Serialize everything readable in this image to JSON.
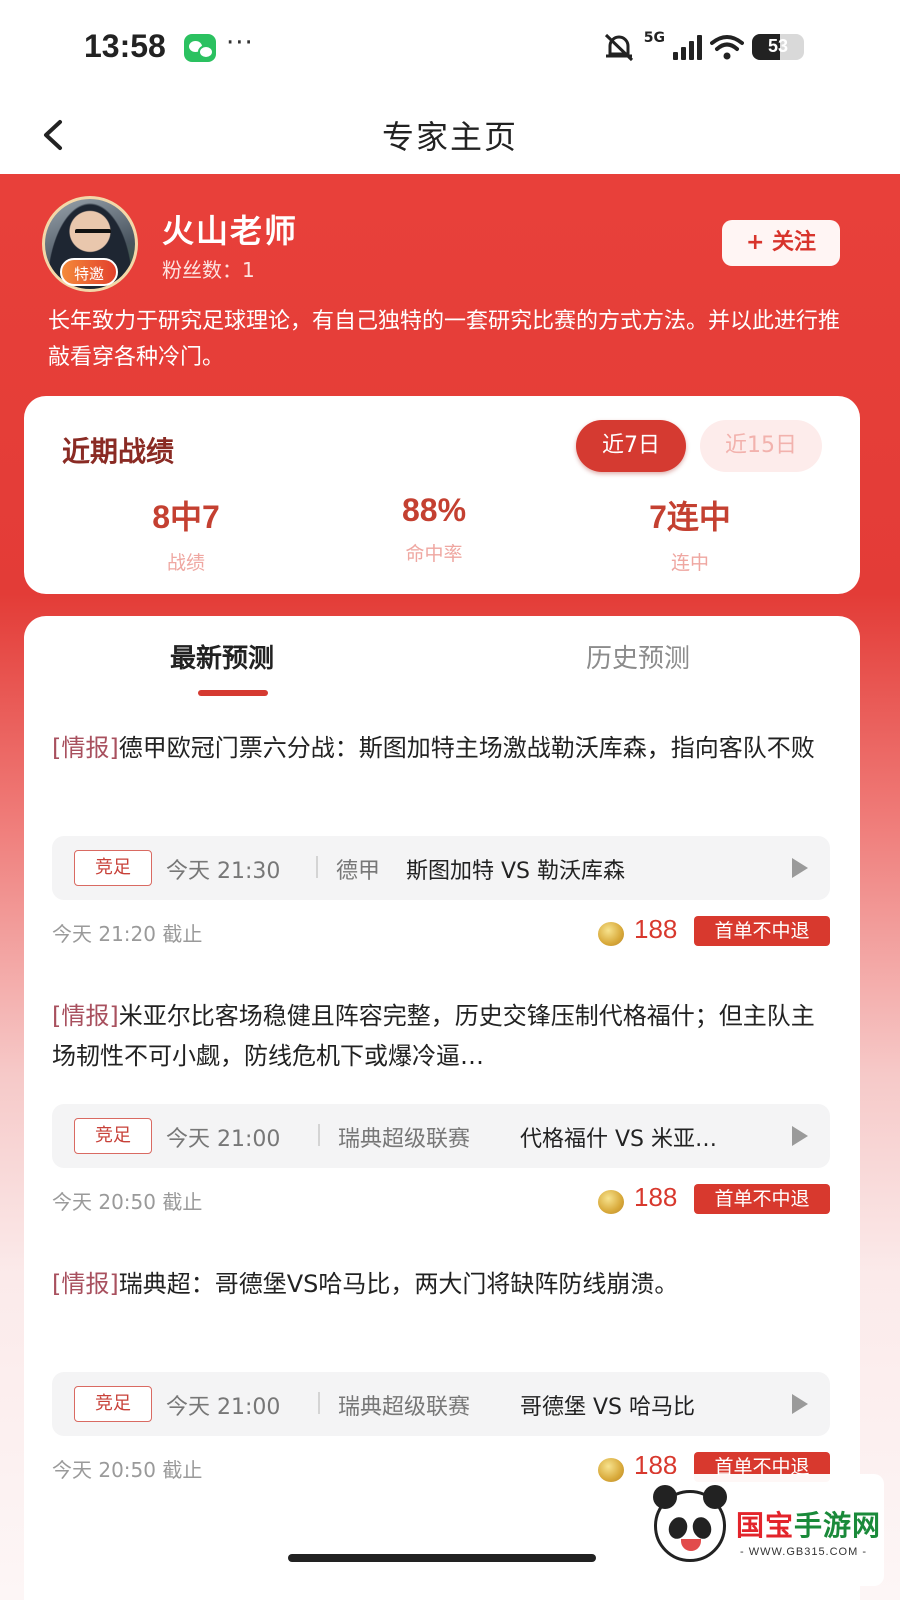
{
  "status_bar": {
    "time": "13:58",
    "dots": "···",
    "network": "5G",
    "battery": "53",
    "icons": [
      "wechat-icon",
      "silent-icon",
      "signal-icon",
      "wifi-icon",
      "battery-icon"
    ]
  },
  "nav": {
    "title": "专家主页",
    "back_icon": "chevron-left-icon"
  },
  "expert": {
    "name": "火山老师",
    "badge": "特邀",
    "fans": "粉丝数：1",
    "follow_label": "+ 关注",
    "intro": "长年致力于研究足球理论，有自己独特的一套研究比赛的方式方法。并以此进行推敲看穿各种冷门。"
  },
  "record": {
    "title": "近期战绩",
    "periods": [
      {
        "label": "近7日",
        "active": true
      },
      {
        "label": "近15日",
        "active": false
      }
    ],
    "stats": [
      {
        "value": "8中7",
        "label": "战绩"
      },
      {
        "value": "88%",
        "label": "命中率"
      },
      {
        "value": "7连中",
        "label": "连中"
      }
    ]
  },
  "tabs": [
    {
      "label": "最新预测",
      "active": true
    },
    {
      "label": "历史预测",
      "active": false
    }
  ],
  "predictions": [
    {
      "tag": "[情报]",
      "title": "德甲欧冠门票六分战：斯图加特主场激战勒沃库森，指向客队不败",
      "lottery": "竞足",
      "time": "今天 21:30",
      "league": "德甲",
      "teams": "斯图加特 VS 勒沃库森",
      "deadline": "今天 21:20 截止",
      "price": "188",
      "refund": "首单不中退"
    },
    {
      "tag": "[情报]",
      "title": "米亚尔比客场稳健且阵容完整，历史交锋压制代格福什；但主队主场韧性不可小觑，防线危机下或爆冷逼…",
      "lottery": "竞足",
      "time": "今天 21:00",
      "league": "瑞典超级联赛",
      "teams": "代格福什 VS 米亚…",
      "deadline": "今天 20:50 截止",
      "price": "188",
      "refund": "首单不中退"
    },
    {
      "tag": "[情报]",
      "title": "瑞典超：哥德堡VS哈马比，两大门将缺阵防线崩溃。",
      "lottery": "竞足",
      "time": "今天 21:00",
      "league": "瑞典超级联赛",
      "teams": "哥德堡 VS 哈马比",
      "deadline": "今天 20:50 截止",
      "price": "188",
      "refund": "首单不中退"
    }
  ],
  "watermark": {
    "title_red": "国宝",
    "title_green": "手游网",
    "url": "- WWW.GB315.COM -"
  },
  "colors": {
    "brand_red": "#d53a31",
    "header_red": "#e8403a",
    "price_red": "#d8392e"
  }
}
